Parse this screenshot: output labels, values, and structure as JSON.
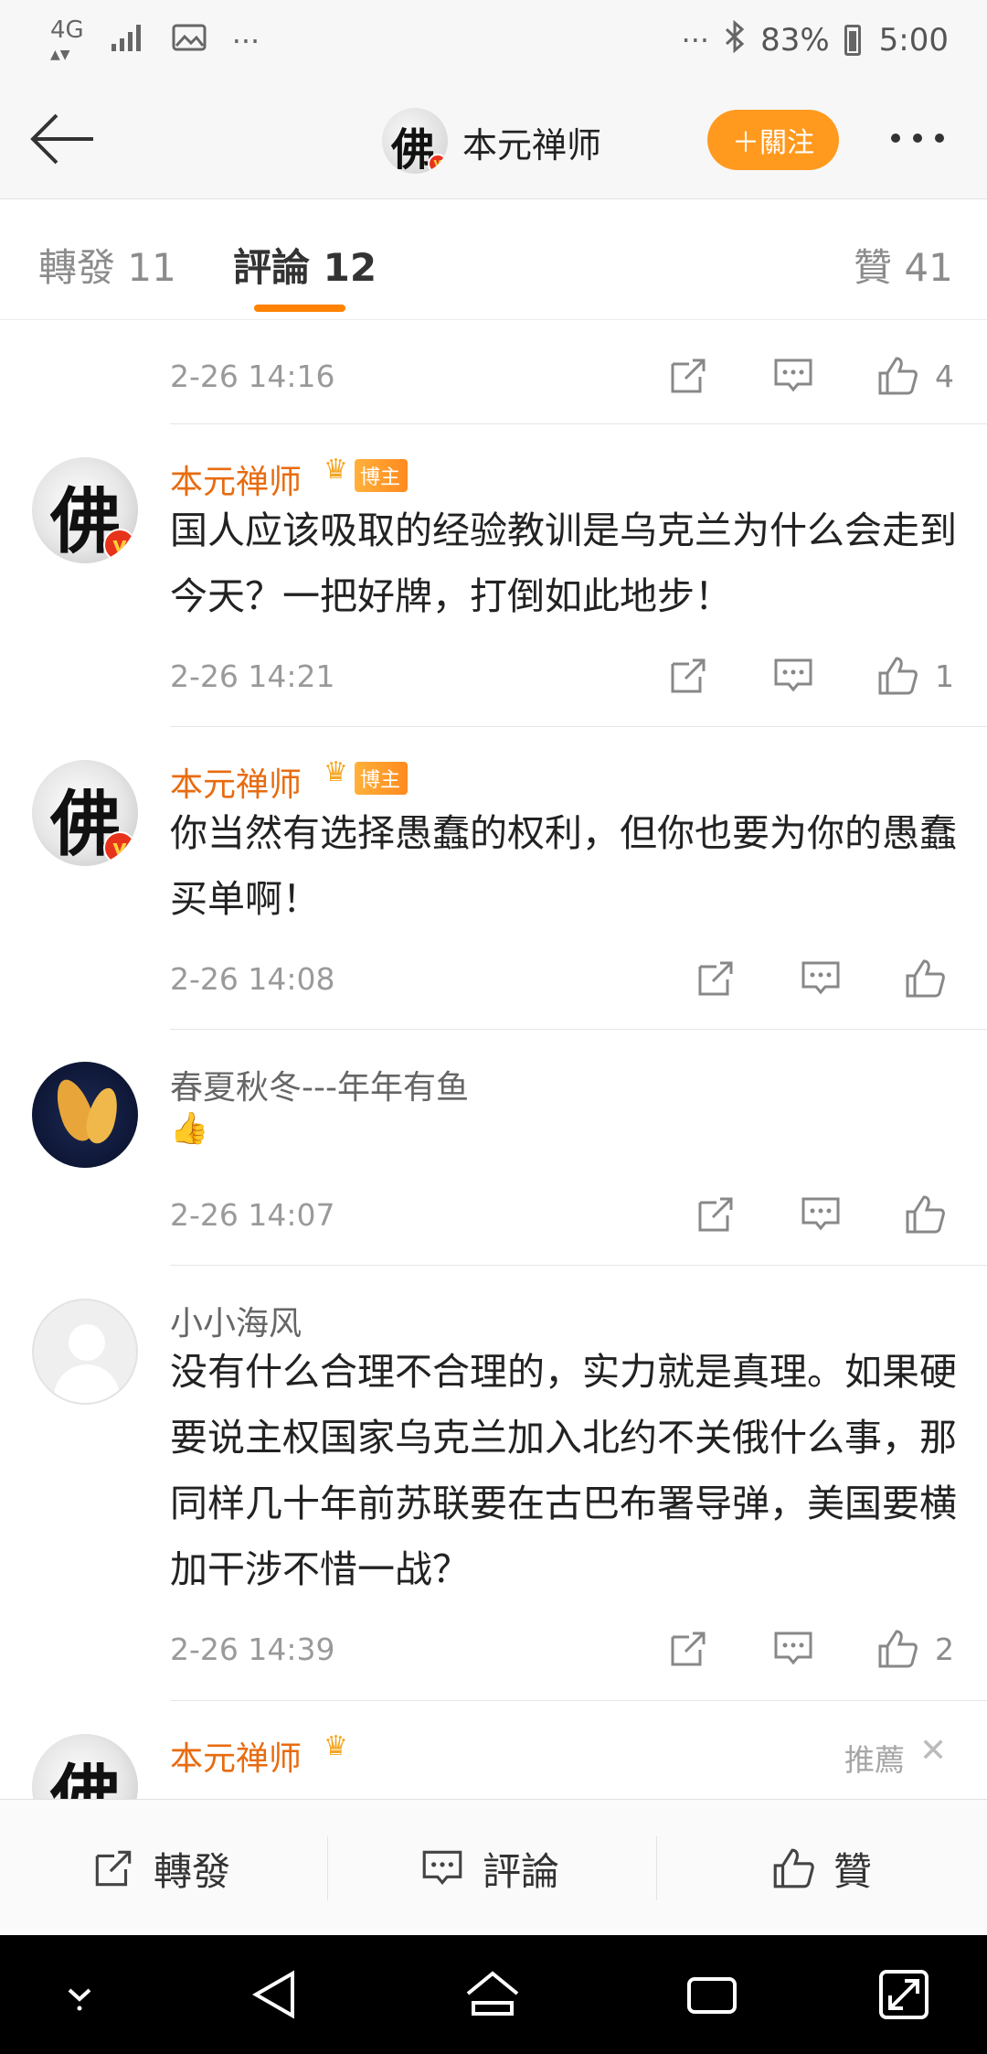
{
  "status_bar": {
    "network": "4G",
    "network_arrows": "▲▼",
    "overflow_left": "···",
    "overflow_right": "···",
    "bluetooth": "✱",
    "battery": "83%",
    "time": "5:00"
  },
  "header": {
    "avatar_glyph": "佛",
    "name": "本元禅师",
    "follow_label": "＋關注"
  },
  "tabs": [
    {
      "label": "轉發 11"
    },
    {
      "label": "評論 12"
    },
    {
      "label": "贊 41"
    }
  ],
  "comments": [
    {
      "time": "2-26 14:16",
      "likes": "4"
    },
    {
      "user": "本元禅师",
      "host_badge": "博主",
      "text": "国人应该吸取的经验教训是乌克兰为什么会走到今天？一把好牌，打倒如此地步！",
      "time": "2-26 14:21",
      "likes": "1"
    },
    {
      "user": "本元禅师",
      "host_badge": "博主",
      "text": "你当然有选择愚蠢的权利，但你也要为你的愚蠢买单啊！",
      "time": "2-26 14:08",
      "likes": ""
    },
    {
      "user": "春夏秋冬---年年有鱼",
      "emoji": "👍",
      "time": "2-26 14:07",
      "likes": ""
    },
    {
      "user": "小小海风",
      "text": "没有什么合理不合理的，实力就是真理。如果硬要说主权国家乌克兰加入北约不关俄什么事，那同样几十年前苏联要在古巴布署导弹，美国要横加干涉不惜一战？",
      "time": "2-26 14:39",
      "likes": "2"
    },
    {
      "user": "本元禅师",
      "recommend": "推薦",
      "close": "✕"
    }
  ],
  "bottom_bar": {
    "repost": "轉發",
    "comment": "評論",
    "like": "贊"
  },
  "colors": {
    "accent_orange": "#ff9a1f",
    "username_orange": "#e86b0f",
    "tab_underline": "#ff8200"
  }
}
